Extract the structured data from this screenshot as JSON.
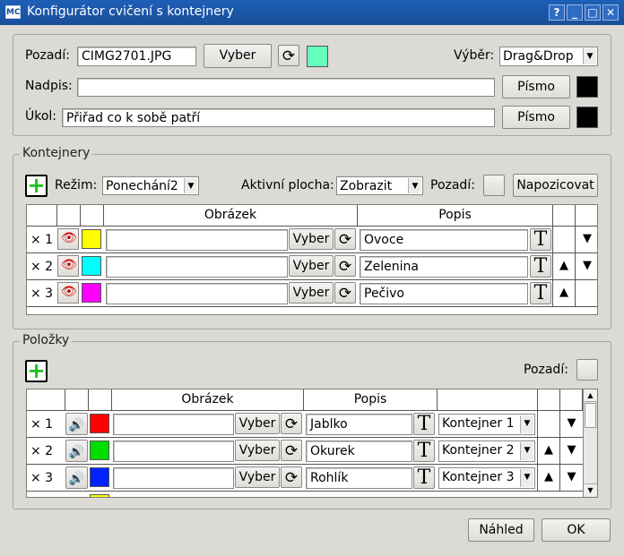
{
  "window": {
    "app_icon_text": "MC",
    "title": "Konfigurátor cvičení s kontejnery",
    "buttons": {
      "help": "?",
      "minimize": "_",
      "maximize": "□",
      "close": "✕"
    }
  },
  "top": {
    "background_label": "Pozadí:",
    "background_value": "CIMG2701.JPG",
    "browse_label": "Vyber",
    "background_color": "#66ffbb",
    "selection_label": "Výběr:",
    "selection_value": "Drag&Drop",
    "caption_label": "Nadpis:",
    "caption_value": "",
    "font_label": "Písmo",
    "caption_color": "#000000",
    "task_label": "Úkol:",
    "task_value": "Přiřad co k sobě patří",
    "task_color": "#000000"
  },
  "containers": {
    "group_title": "Kontejnery",
    "mode_label": "Režim:",
    "mode_value": "Ponechání2",
    "active_area_label": "Aktivní plocha:",
    "active_area_value": "Zobrazit",
    "background_label": "Pozadí:",
    "position_label": "Napozicovat",
    "col_image": "Obrázek",
    "col_desc": "Popis",
    "browse_label": "Vyber",
    "rows": [
      {
        "num": "× 1",
        "color": "#ffff00",
        "image": "",
        "desc": "Ovoce"
      },
      {
        "num": "× 2",
        "color": "#00ffff",
        "image": "",
        "desc": "Zelenina"
      },
      {
        "num": "× 3",
        "color": "#ff00ff",
        "image": "",
        "desc": "Pečivo"
      }
    ]
  },
  "items": {
    "group_title": "Položky",
    "background_label": "Pozadí:",
    "col_image": "Obrázek",
    "col_desc": "Popis",
    "browse_label": "Vyber",
    "rows": [
      {
        "num": "×  1",
        "color": "#ff0000",
        "image": "",
        "desc": "Jablko",
        "container": "Kontejner 1"
      },
      {
        "num": "×  2",
        "color": "#00dd00",
        "image": "",
        "desc": "Okurek",
        "container": "Kontejner 2"
      },
      {
        "num": "×  3",
        "color": "#0022ff",
        "image": "",
        "desc": "Rohlík",
        "container": "Kontejner 3"
      }
    ]
  },
  "footer": {
    "preview_label": "Náhled",
    "ok_label": "OK"
  },
  "icons": {
    "refresh": "refresh-icon",
    "eye": "hidden-eye-icon",
    "speaker": "speaker-icon",
    "text": "text-style-icon",
    "up": "arrow-up-icon",
    "down": "arrow-down-icon",
    "add": "add-icon"
  }
}
